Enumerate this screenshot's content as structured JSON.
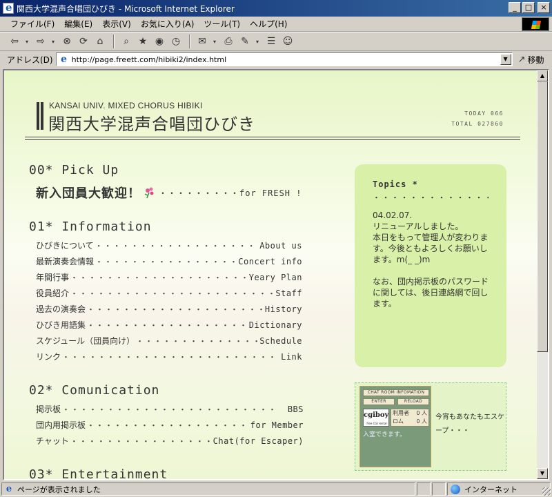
{
  "window": {
    "title": "関西大学混声合唱団ひびき - Microsoft Internet Explorer",
    "buttons": {
      "minimize": "_",
      "maximize": "□",
      "close": "×"
    }
  },
  "menubar": {
    "items": [
      "ファイル(F)",
      "編集(E)",
      "表示(V)",
      "お気に入り(A)",
      "ツール(T)",
      "ヘルプ(H)"
    ]
  },
  "toolbar": {
    "icons": [
      "back-icon",
      "forward-icon",
      "stop-icon",
      "refresh-icon",
      "home-icon",
      "search-icon",
      "favorites-icon",
      "history-icon",
      "media-icon",
      "mail-icon",
      "print-icon",
      "edit-icon",
      "discuss-icon",
      "messenger-icon"
    ],
    "glyphs": {
      "back": "⇦",
      "forward": "⇨",
      "dropdown": "▾",
      "stop": "⊗",
      "refresh": "⟳",
      "home": "⌂",
      "search": "⌕",
      "favorites": "★",
      "history": "◷",
      "media": "◉",
      "mail": "✉",
      "print": "⎙",
      "edit": "✎",
      "discuss": "☰",
      "messenger": "☺"
    }
  },
  "address": {
    "label": "アドレス(D)",
    "url": "http://page.freett.com/hibiki2/index.html",
    "go_label": "移動"
  },
  "header": {
    "en_title": "KANSAI UNIV. MIXED CHORUS HIBIKI",
    "ja_title": "関西大学混声合唱団ひびき",
    "today": "TODAY 066",
    "total": "TOTAL 027860"
  },
  "sections": {
    "pickup": {
      "heading": "00* Pick Up",
      "fresh_title": "新入団員大歓迎！",
      "fresh_dots": "・・・・・・・・・for FRESH !"
    },
    "information": {
      "heading": "01* Information",
      "items": [
        {
          "ja": "ひびきについて",
          "en": "About us"
        },
        {
          "ja": "最新演奏会情報",
          "en": "Concert info"
        },
        {
          "ja": "年間行事",
          "en": "Yeary Plan"
        },
        {
          "ja": "役員紹介",
          "en": "Staff"
        },
        {
          "ja": "過去の演奏会",
          "en": "History"
        },
        {
          "ja": "ひびき用語集",
          "en": "Dictionary"
        },
        {
          "ja": "スケジュール（団員向け）",
          "en": "Schedule"
        },
        {
          "ja": "リンク",
          "en": "Link"
        }
      ]
    },
    "communication": {
      "heading": "02* Comunication",
      "items": [
        {
          "ja": "掲示板",
          "en": "BBS"
        },
        {
          "ja": "団内用掲示板",
          "en": "for Member"
        },
        {
          "ja": "チャット",
          "en": "Chat(for Escaper)"
        }
      ]
    },
    "entertainment": {
      "heading": "03* Entertainment"
    }
  },
  "topics": {
    "title": "Topics *",
    "dots": "・・・・・・・・・・・・・・・",
    "body": "04.02.07.\nリニューアルしました。\n本日をもって管理人が変わります。今後ともよろしくお願いします。m(_ _)m\n\nなお、団内掲示板のパスワードに関しては、後日連絡網で回します。"
  },
  "chat": {
    "room_info": "CHAT ROOM INFOMATION",
    "enter": "ENTER",
    "reload": "RELOAD",
    "logo": "cgiboy",
    "logo_sub": "free CGI rental",
    "users_label": "利用者",
    "users_count": "0 人",
    "rom_label": "ロム",
    "rom_count": "0 人",
    "enter_note": "入室できます。",
    "caption": "今宵もあなたもエスケープ・・・"
  },
  "status": {
    "text": "ページが表示されました",
    "zone": "インターネット"
  },
  "colors": {
    "titlebar": "#0a246a",
    "topics_bg": "#d8f0a8",
    "page_bg": "#f4fbe2",
    "text": "#333333"
  }
}
